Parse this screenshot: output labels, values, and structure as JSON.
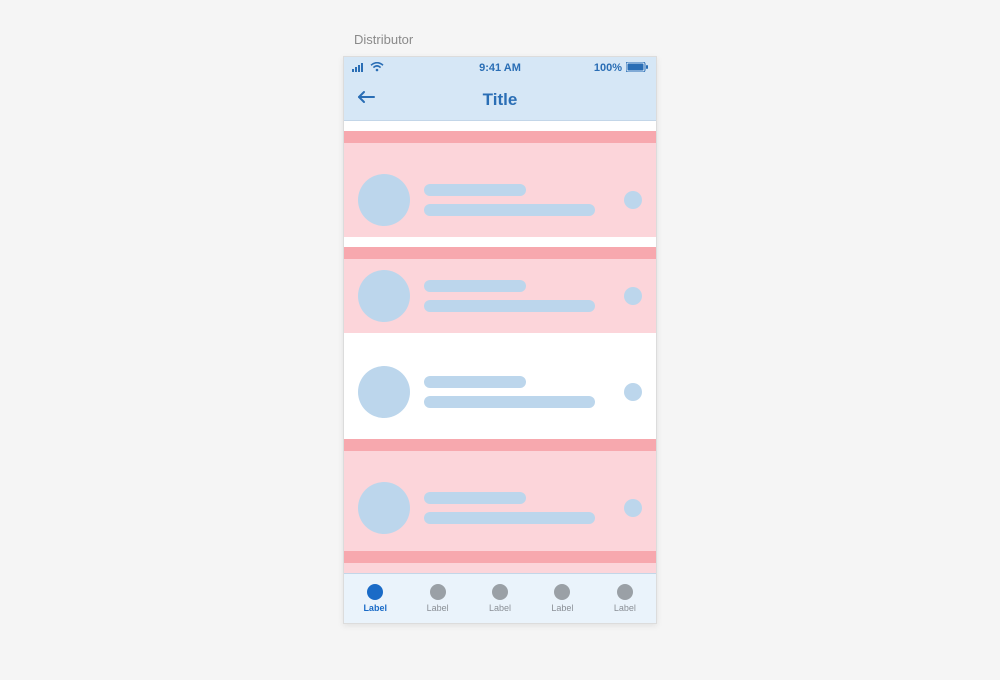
{
  "meta": {
    "page_label": "Distributor"
  },
  "statusbar": {
    "time": "9:41 AM",
    "battery": "100%"
  },
  "navbar": {
    "title": "Title"
  },
  "tabs": [
    {
      "label": "Label",
      "active": true
    },
    {
      "label": "Label",
      "active": false
    },
    {
      "label": "Label",
      "active": false
    },
    {
      "label": "Label",
      "active": false
    },
    {
      "label": "Label",
      "active": false
    }
  ]
}
